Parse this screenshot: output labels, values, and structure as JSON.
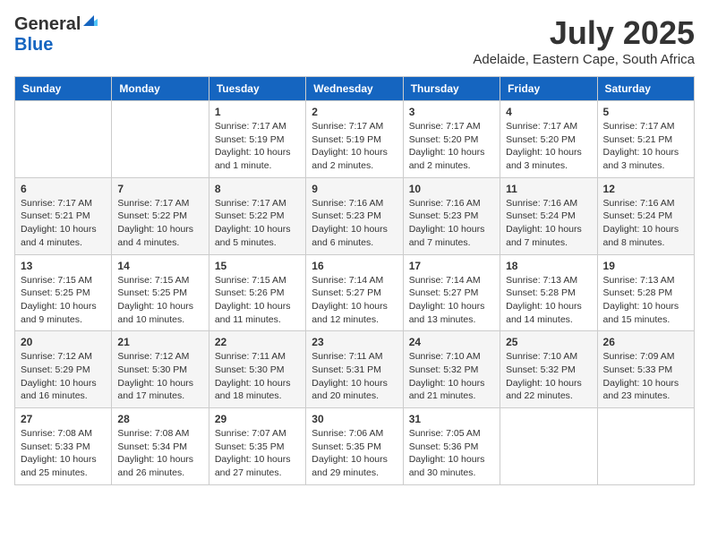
{
  "header": {
    "logo_general": "General",
    "logo_blue": "Blue",
    "month_year": "July 2025",
    "location": "Adelaide, Eastern Cape, South Africa"
  },
  "calendar": {
    "days_of_week": [
      "Sunday",
      "Monday",
      "Tuesday",
      "Wednesday",
      "Thursday",
      "Friday",
      "Saturday"
    ],
    "weeks": [
      [
        {
          "day": "",
          "info": ""
        },
        {
          "day": "",
          "info": ""
        },
        {
          "day": "1",
          "info": "Sunrise: 7:17 AM\nSunset: 5:19 PM\nDaylight: 10 hours and 1 minute."
        },
        {
          "day": "2",
          "info": "Sunrise: 7:17 AM\nSunset: 5:19 PM\nDaylight: 10 hours and 2 minutes."
        },
        {
          "day": "3",
          "info": "Sunrise: 7:17 AM\nSunset: 5:20 PM\nDaylight: 10 hours and 2 minutes."
        },
        {
          "day": "4",
          "info": "Sunrise: 7:17 AM\nSunset: 5:20 PM\nDaylight: 10 hours and 3 minutes."
        },
        {
          "day": "5",
          "info": "Sunrise: 7:17 AM\nSunset: 5:21 PM\nDaylight: 10 hours and 3 minutes."
        }
      ],
      [
        {
          "day": "6",
          "info": "Sunrise: 7:17 AM\nSunset: 5:21 PM\nDaylight: 10 hours and 4 minutes."
        },
        {
          "day": "7",
          "info": "Sunrise: 7:17 AM\nSunset: 5:22 PM\nDaylight: 10 hours and 4 minutes."
        },
        {
          "day": "8",
          "info": "Sunrise: 7:17 AM\nSunset: 5:22 PM\nDaylight: 10 hours and 5 minutes."
        },
        {
          "day": "9",
          "info": "Sunrise: 7:16 AM\nSunset: 5:23 PM\nDaylight: 10 hours and 6 minutes."
        },
        {
          "day": "10",
          "info": "Sunrise: 7:16 AM\nSunset: 5:23 PM\nDaylight: 10 hours and 7 minutes."
        },
        {
          "day": "11",
          "info": "Sunrise: 7:16 AM\nSunset: 5:24 PM\nDaylight: 10 hours and 7 minutes."
        },
        {
          "day": "12",
          "info": "Sunrise: 7:16 AM\nSunset: 5:24 PM\nDaylight: 10 hours and 8 minutes."
        }
      ],
      [
        {
          "day": "13",
          "info": "Sunrise: 7:15 AM\nSunset: 5:25 PM\nDaylight: 10 hours and 9 minutes."
        },
        {
          "day": "14",
          "info": "Sunrise: 7:15 AM\nSunset: 5:25 PM\nDaylight: 10 hours and 10 minutes."
        },
        {
          "day": "15",
          "info": "Sunrise: 7:15 AM\nSunset: 5:26 PM\nDaylight: 10 hours and 11 minutes."
        },
        {
          "day": "16",
          "info": "Sunrise: 7:14 AM\nSunset: 5:27 PM\nDaylight: 10 hours and 12 minutes."
        },
        {
          "day": "17",
          "info": "Sunrise: 7:14 AM\nSunset: 5:27 PM\nDaylight: 10 hours and 13 minutes."
        },
        {
          "day": "18",
          "info": "Sunrise: 7:13 AM\nSunset: 5:28 PM\nDaylight: 10 hours and 14 minutes."
        },
        {
          "day": "19",
          "info": "Sunrise: 7:13 AM\nSunset: 5:28 PM\nDaylight: 10 hours and 15 minutes."
        }
      ],
      [
        {
          "day": "20",
          "info": "Sunrise: 7:12 AM\nSunset: 5:29 PM\nDaylight: 10 hours and 16 minutes."
        },
        {
          "day": "21",
          "info": "Sunrise: 7:12 AM\nSunset: 5:30 PM\nDaylight: 10 hours and 17 minutes."
        },
        {
          "day": "22",
          "info": "Sunrise: 7:11 AM\nSunset: 5:30 PM\nDaylight: 10 hours and 18 minutes."
        },
        {
          "day": "23",
          "info": "Sunrise: 7:11 AM\nSunset: 5:31 PM\nDaylight: 10 hours and 20 minutes."
        },
        {
          "day": "24",
          "info": "Sunrise: 7:10 AM\nSunset: 5:32 PM\nDaylight: 10 hours and 21 minutes."
        },
        {
          "day": "25",
          "info": "Sunrise: 7:10 AM\nSunset: 5:32 PM\nDaylight: 10 hours and 22 minutes."
        },
        {
          "day": "26",
          "info": "Sunrise: 7:09 AM\nSunset: 5:33 PM\nDaylight: 10 hours and 23 minutes."
        }
      ],
      [
        {
          "day": "27",
          "info": "Sunrise: 7:08 AM\nSunset: 5:33 PM\nDaylight: 10 hours and 25 minutes."
        },
        {
          "day": "28",
          "info": "Sunrise: 7:08 AM\nSunset: 5:34 PM\nDaylight: 10 hours and 26 minutes."
        },
        {
          "day": "29",
          "info": "Sunrise: 7:07 AM\nSunset: 5:35 PM\nDaylight: 10 hours and 27 minutes."
        },
        {
          "day": "30",
          "info": "Sunrise: 7:06 AM\nSunset: 5:35 PM\nDaylight: 10 hours and 29 minutes."
        },
        {
          "day": "31",
          "info": "Sunrise: 7:05 AM\nSunset: 5:36 PM\nDaylight: 10 hours and 30 minutes."
        },
        {
          "day": "",
          "info": ""
        },
        {
          "day": "",
          "info": ""
        }
      ]
    ]
  }
}
